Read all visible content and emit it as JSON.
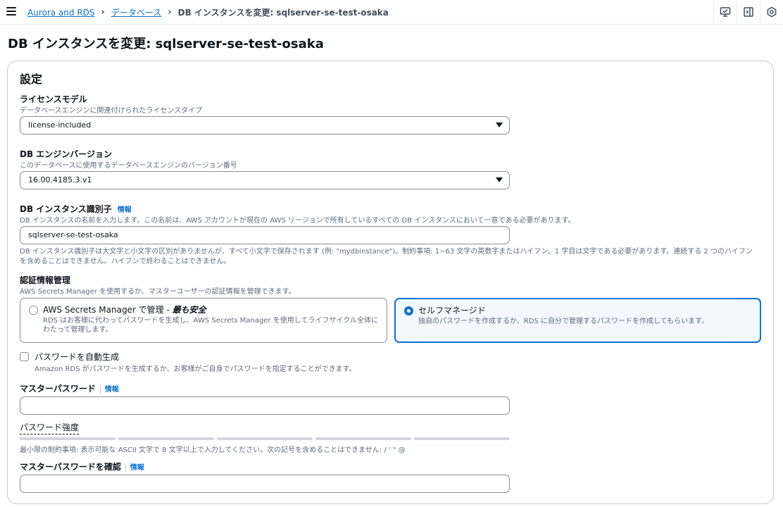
{
  "breadcrumb": {
    "items": [
      "Aurora and RDS",
      "データベース"
    ],
    "current": "DB インスタンスを変更: sqlserver-se-test-osaka"
  },
  "toolbar_icons": [
    "feedback-icon",
    "panel-icon",
    "settings-icon"
  ],
  "page": {
    "title": "DB インスタンスを変更: sqlserver-se-test-osaka"
  },
  "settings": {
    "title": "設定",
    "license": {
      "label": "ライセンスモデル",
      "description": "データベースエンジンに関連付けられたライセンスタイプ",
      "value": "license-included"
    },
    "engine_version": {
      "label": "DB エンジンバージョン",
      "description": "このデータベースに使用するデータベースエンジンのバージョン番号",
      "value": "16.00.4185.3.v1"
    },
    "identifier": {
      "label": "DB インスタンス識別子",
      "info": "情報",
      "description": "DB インスタンスの名前を入力します。この名前は、AWS アカウントが現在の AWS リージョンで所有しているすべての DB インスタンスにおいて一意である必要があります。",
      "value": "sqlserver-se-test-osaka",
      "constraint_line1": "DB インスタンス識別子は大文字と小文字の区別がありませんが、すべて小文字で保存されます (例: \"mydbinstance\")。制約事項: 1~63 文字の英数字またはハイフン。1 字目は文字である必要があります。連続する 2 つのハイフン",
      "constraint_line2": "を含めることはできません。ハイフンで終わることはできません。"
    },
    "credentials": {
      "label": "認証情報管理",
      "description": "AWS Secrets Manager を使用するか、マスターユーザーの認証情報を管理できます。",
      "option1_title_prefix": "AWS Secrets Manager で管理 - ",
      "option1_title_emphasis": "最も安全",
      "option1_desc_line1": "RDS はお客様に代わってパスワードを生成し、AWS Secrets Manager を使用してライフサイクル全体に",
      "option1_desc_line2": "わたって管理します。",
      "option2_title": "セルフマネージド",
      "option2_desc": "独自のパスワードを作成するか、RDS に自分で管理するパスワードを作成してもらいます。",
      "selected": "self-managed"
    },
    "auto_generate": {
      "label": "パスワードを自動生成",
      "description": "Amazon RDS がパスワードを生成するか、お客様がご自身でパスワードを指定することができます。",
      "checked": false
    },
    "master_password": {
      "label": "マスターパスワード",
      "info": "情報",
      "value": ""
    },
    "password_strength": {
      "label": "パスワード強度",
      "constraint": "最小限の制約事項: 表示可能な ASCII 文字で 8 文字以上で入力してください。次の記号を含めることはできません: / ' \" @"
    },
    "confirm_password": {
      "label": "マスターパスワードを確認",
      "info": "情報",
      "value": ""
    }
  },
  "colors": {
    "link": "#0972d3",
    "border": "#8c8c94",
    "selected_bg": "#f2f8fd"
  }
}
